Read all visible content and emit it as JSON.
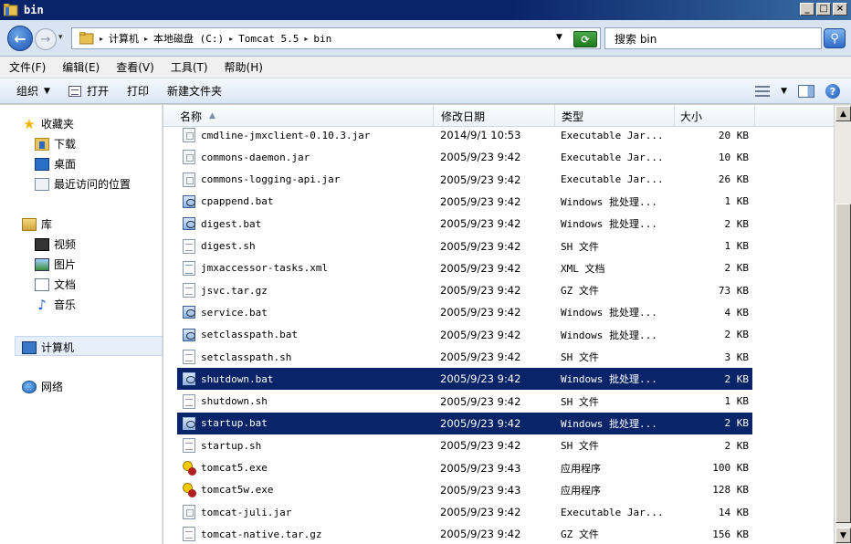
{
  "window": {
    "title": "bin",
    "controls": [
      "_",
      "□",
      "×"
    ]
  },
  "address": {
    "crumbs": [
      "计算机",
      "本地磁盘 (C:)",
      "Tomcat 5.5",
      "bin"
    ],
    "search_placeholder": "搜索 bin"
  },
  "menu": [
    "文件(F)",
    "编辑(E)",
    "查看(V)",
    "工具(T)",
    "帮助(H)"
  ],
  "toolbar": {
    "organize": "组织",
    "open": "打开",
    "print": "打印",
    "new_folder": "新建文件夹"
  },
  "nav": {
    "favorites": "收藏夹",
    "downloads": "下载",
    "desktop": "桌面",
    "recent": "最近访问的位置",
    "libraries": "库",
    "videos": "视频",
    "pictures": "图片",
    "documents": "文档",
    "music": "音乐",
    "computer": "计算机",
    "network": "网络"
  },
  "columns": {
    "name": "名称",
    "date": "修改日期",
    "type": "类型",
    "size": "大小"
  },
  "files": [
    {
      "name": "cmdline-jmxclient-0.10.3.jar",
      "date": "2014/9/1 10:53",
      "type": "Executable Jar...",
      "size": "20 KB",
      "icon": "jar-icon",
      "selected": false
    },
    {
      "name": "commons-daemon.jar",
      "date": "2005/9/23 9:42",
      "type": "Executable Jar...",
      "size": "10 KB",
      "icon": "jar-icon",
      "selected": false
    },
    {
      "name": "commons-logging-api.jar",
      "date": "2005/9/23 9:42",
      "type": "Executable Jar...",
      "size": "26 KB",
      "icon": "jar-icon",
      "selected": false
    },
    {
      "name": "cpappend.bat",
      "date": "2005/9/23 9:42",
      "type": "Windows 批处理...",
      "size": "1 KB",
      "icon": "bat-icon",
      "selected": false
    },
    {
      "name": "digest.bat",
      "date": "2005/9/23 9:42",
      "type": "Windows 批处理...",
      "size": "2 KB",
      "icon": "bat-icon",
      "selected": false
    },
    {
      "name": "digest.sh",
      "date": "2005/9/23 9:42",
      "type": "SH 文件",
      "size": "1 KB",
      "icon": "sh-icon",
      "selected": false
    },
    {
      "name": "jmxaccessor-tasks.xml",
      "date": "2005/9/23 9:42",
      "type": "XML 文档",
      "size": "2 KB",
      "icon": "xml-icon",
      "selected": false
    },
    {
      "name": "jsvc.tar.gz",
      "date": "2005/9/23 9:42",
      "type": "GZ 文件",
      "size": "73 KB",
      "icon": "txt-icon",
      "selected": false
    },
    {
      "name": "service.bat",
      "date": "2005/9/23 9:42",
      "type": "Windows 批处理...",
      "size": "4 KB",
      "icon": "bat-icon",
      "selected": false
    },
    {
      "name": "setclasspath.bat",
      "date": "2005/9/23 9:42",
      "type": "Windows 批处理...",
      "size": "2 KB",
      "icon": "bat-icon",
      "selected": false
    },
    {
      "name": "setclasspath.sh",
      "date": "2005/9/23 9:42",
      "type": "SH 文件",
      "size": "3 KB",
      "icon": "sh-icon",
      "selected": false
    },
    {
      "name": "shutdown.bat",
      "date": "2005/9/23 9:42",
      "type": "Windows 批处理...",
      "size": "2 KB",
      "icon": "bat-icon",
      "selected": true
    },
    {
      "name": "shutdown.sh",
      "date": "2005/9/23 9:42",
      "type": "SH 文件",
      "size": "1 KB",
      "icon": "sh-icon",
      "selected": false
    },
    {
      "name": "startup.bat",
      "date": "2005/9/23 9:42",
      "type": "Windows 批处理...",
      "size": "2 KB",
      "icon": "bat-icon",
      "selected": true
    },
    {
      "name": "startup.sh",
      "date": "2005/9/23 9:42",
      "type": "SH 文件",
      "size": "2 KB",
      "icon": "sh-icon",
      "selected": false
    },
    {
      "name": "tomcat5.exe",
      "date": "2005/9/23 9:43",
      "type": "应用程序",
      "size": "100 KB",
      "icon": "tomcat-exe-icon",
      "selected": false
    },
    {
      "name": "tomcat5w.exe",
      "date": "2005/9/23 9:43",
      "type": "应用程序",
      "size": "128 KB",
      "icon": "tomcat-exe-icon",
      "selected": false
    },
    {
      "name": "tomcat-juli.jar",
      "date": "2005/9/23 9:42",
      "type": "Executable Jar...",
      "size": "14 KB",
      "icon": "jar-icon",
      "selected": false
    },
    {
      "name": "tomcat-native.tar.gz",
      "date": "2005/9/23 9:42",
      "type": "GZ 文件",
      "size": "156 KB",
      "icon": "txt-icon",
      "selected": false
    }
  ],
  "colors": {
    "selection": "#0a246a",
    "title_bar": "#0a246a",
    "address_bg": "#d8e4f1"
  }
}
